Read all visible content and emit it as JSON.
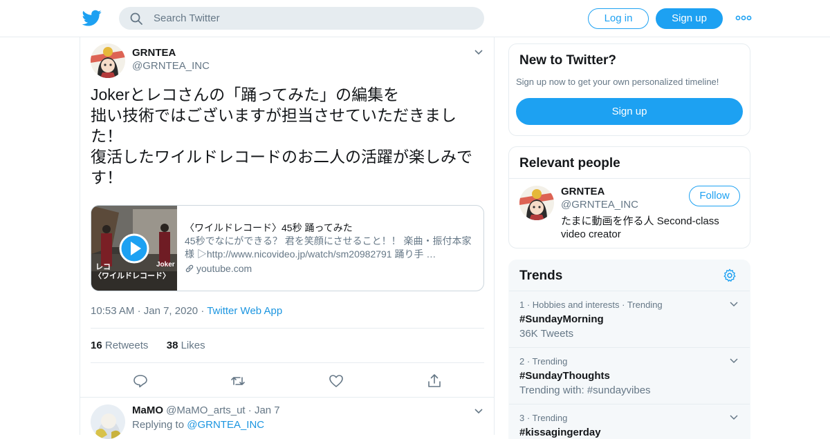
{
  "header": {
    "search_placeholder": "Search Twitter",
    "login_label": "Log in",
    "signup_label": "Sign up"
  },
  "tweet": {
    "name": "GRNTEA",
    "handle": "@GRNTEA_INC",
    "text": "Jokerとレコさんの「踊ってみた」の編集を\n拙い技術ではございますが担当させていただきまし\nた！\n復活したワイルドレコードのお二人の活躍が楽しみで\nす！",
    "card": {
      "title": "〈ワイルドレコード〉45秒 踊ってみた",
      "description": "45秒でなにができる？ 君を笑顔にさせること！！ 楽曲・振付本家様 ▷http://www.nicovideo.jp/watch/sm20982791 踊り手 …",
      "domain": "youtube.com",
      "thumb_label_left": "レコ",
      "thumb_label_right": "Joker",
      "thumb_caption": "〈ワイルドレコード〉"
    },
    "time": "10:53 AM",
    "date": "Jan 7, 2020",
    "source": "Twitter Web App",
    "retweets_count": "16",
    "retweets_label": "Retweets",
    "likes_count": "38",
    "likes_label": "Likes"
  },
  "reply": {
    "name": "MaMO",
    "handle": "@MaMO_arts_ut",
    "date": "Jan 7",
    "replying_label": "Replying to",
    "replying_to": "@GRNTEA_INC"
  },
  "new_to_twitter": {
    "title": "New to Twitter?",
    "subtitle": "Sign up now to get your own personalized timeline!",
    "button": "Sign up"
  },
  "relevant_people": {
    "title": "Relevant people",
    "name": "GRNTEA",
    "handle": "@GRNTEA_INC",
    "bio": "たまに動画を作る人 Second-class video creator",
    "follow_label": "Follow"
  },
  "trends": {
    "title": "Trends",
    "items": [
      {
        "context": "1 · Hobbies and interests · Trending",
        "tag": "#SundayMorning",
        "sub": "36K Tweets"
      },
      {
        "context": "2 · Trending",
        "tag": "#SundayThoughts",
        "sub": "Trending with: #sundayvibes"
      },
      {
        "context": "3 · Trending",
        "tag": "#kissagingerday",
        "sub": ""
      }
    ]
  },
  "colors": {
    "brand": "#1da1f2",
    "link": "#1b95e0",
    "text": "#14171a",
    "secondary": "#657786",
    "border": "#e6ecf0"
  }
}
